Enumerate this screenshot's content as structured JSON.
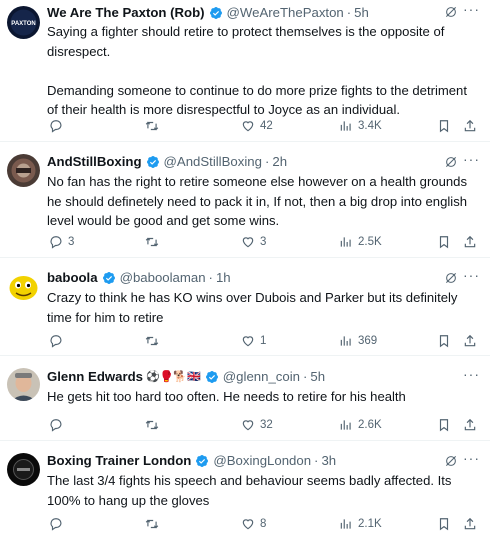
{
  "tweets": [
    {
      "name": "We Are The Paxton (Rob)",
      "handle": "@WeAreThePaxton",
      "sep": "·",
      "time": "5h",
      "emoji": "",
      "text": [
        "Saying a fighter should retire to protect themselves is the opposite of disrespect.",
        "Demanding someone to continue to do more prize fights to the detriment of their health is more disrespectful to Joyce as an individual."
      ],
      "replies": "",
      "retweets": "",
      "likes": "42",
      "views": "3.4K",
      "avatar_label": "PAXTON"
    },
    {
      "name": "AndStillBoxing",
      "handle": "@AndStillBoxing",
      "sep": "·",
      "time": "2h",
      "emoji": "",
      "text": [
        "No fan has the right to retire someone else however on a health grounds he should definetely need to pack it in, If not, then a big drop into english level would be good and get some wins."
      ],
      "replies": "3",
      "retweets": "",
      "likes": "3",
      "views": "2.5K",
      "avatar_label": ""
    },
    {
      "name": "baboola",
      "handle": "@baboolaman",
      "sep": "·",
      "time": "1h",
      "emoji": "",
      "text": [
        "Crazy to think he has KO wins over Dubois and Parker but its definitely time for him to retire"
      ],
      "replies": "",
      "retweets": "",
      "likes": "1",
      "views": "369",
      "avatar_label": ""
    },
    {
      "name": "Glenn Edwards",
      "handle": "@glenn_coin",
      "sep": "·",
      "time": "5h",
      "emoji": "⚽🥊🐕🇬🇧",
      "text": [
        "He gets hit too hard too often. He needs to retire for his health"
      ],
      "replies": "",
      "retweets": "",
      "likes": "32",
      "views": "2.6K",
      "avatar_label": ""
    },
    {
      "name": "Boxing Trainer London",
      "handle": "@BoxingLondon",
      "sep": "·",
      "time": "3h",
      "emoji": "",
      "text": [
        "The last 3/4 fights his speech and behaviour seems badly affected. Its 100% to hang up the gloves"
      ],
      "replies": "",
      "retweets": "",
      "likes": "8",
      "views": "2.1K",
      "avatar_label": ""
    }
  ],
  "icons": {
    "reply": "reply-icon",
    "retweet": "retweet-icon",
    "like": "like-icon",
    "views": "views-icon",
    "bookmark": "bookmark-icon",
    "share": "share-icon",
    "grok": "grok-icon",
    "more": "more-icon",
    "verified": "verified-badge-icon"
  },
  "colors": {
    "verified": "#1d9bf0",
    "text": "#0f1419",
    "muted": "#536471",
    "divider": "#eff3f4"
  },
  "more_label": "···"
}
